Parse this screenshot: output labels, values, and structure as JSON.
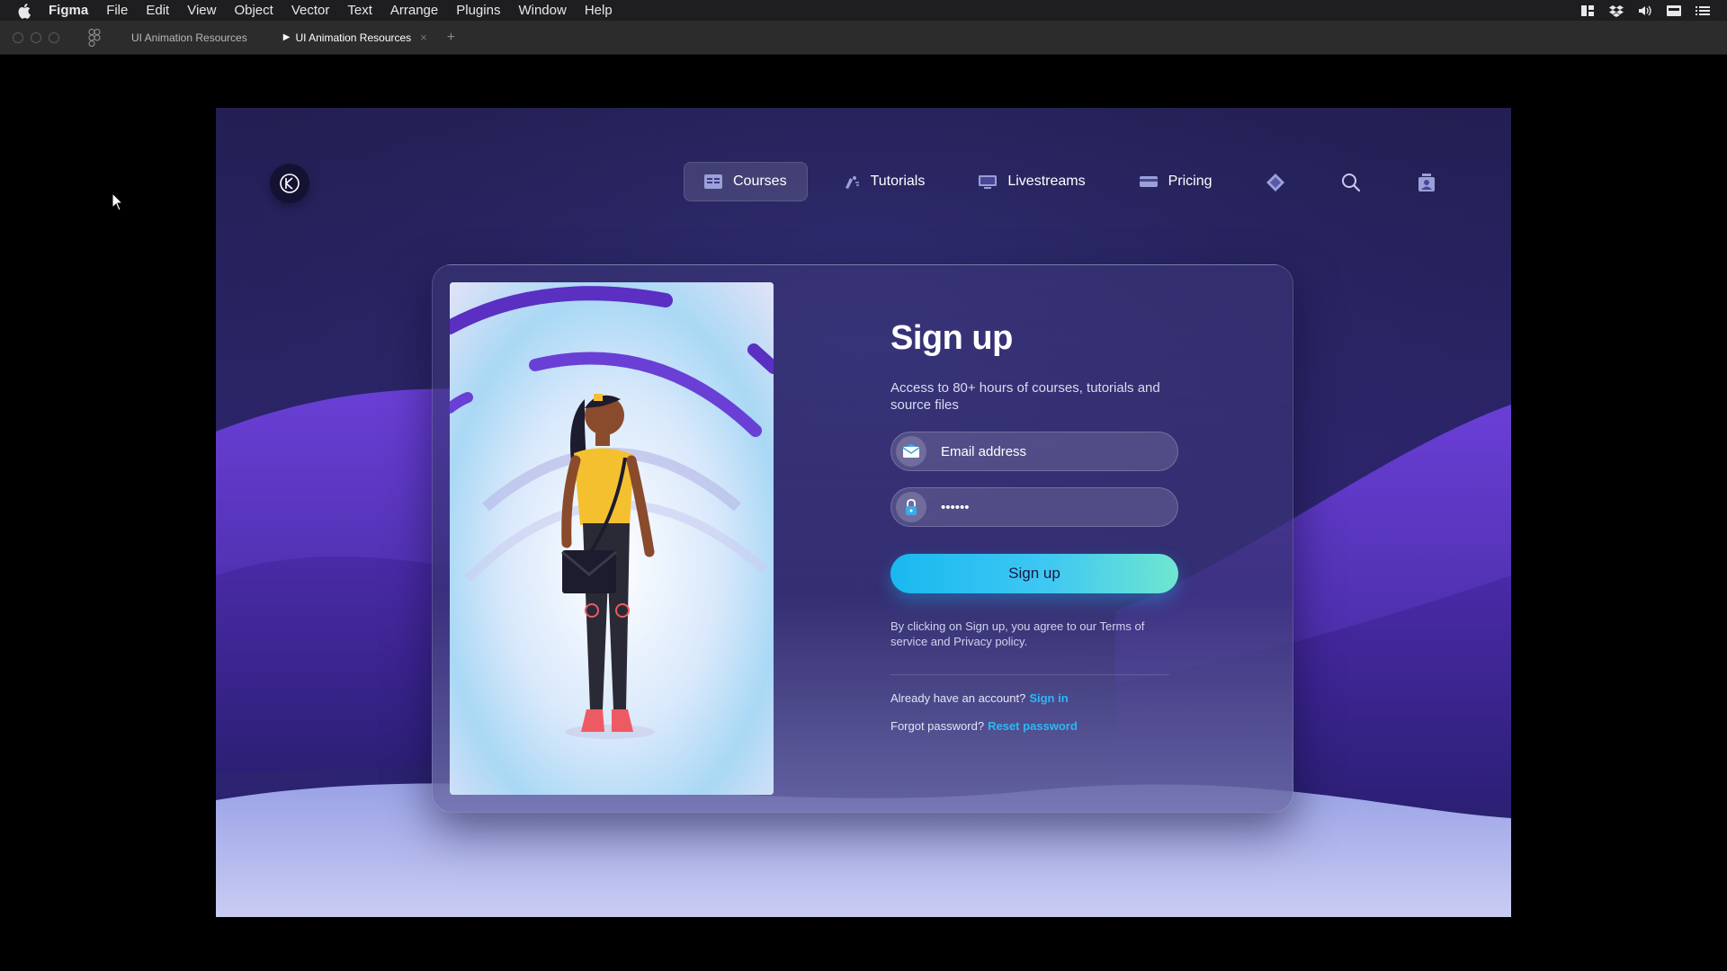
{
  "menubar": {
    "app": "Figma",
    "items": [
      "File",
      "Edit",
      "View",
      "Object",
      "Vector",
      "Text",
      "Arrange",
      "Plugins",
      "Window",
      "Help"
    ],
    "tray_icons": [
      "layout-icon",
      "dropbox-icon",
      "volume-icon",
      "flag-icon",
      "list-icon"
    ]
  },
  "tabbar": {
    "tabs": [
      {
        "label": "UI Animation Resources",
        "active": false
      },
      {
        "label": "UI Animation Resources",
        "active": true
      }
    ],
    "close_glyph": "×",
    "add_glyph": "+"
  },
  "site": {
    "nav": [
      {
        "label": "Courses",
        "icon": "courses-icon",
        "active": true
      },
      {
        "label": "Tutorials",
        "icon": "tutorials-icon",
        "active": false
      },
      {
        "label": "Livestreams",
        "icon": "livestreams-icon",
        "active": false
      },
      {
        "label": "Pricing",
        "icon": "pricing-icon",
        "active": false
      }
    ],
    "nav_icons": [
      "diamond-icon",
      "search-icon",
      "account-icon"
    ]
  },
  "signup": {
    "title": "Sign up",
    "subtitle": "Access to 80+ hours of courses, tutorials and source files",
    "email_placeholder": "Email address",
    "password_value": "••••••",
    "button": "Sign up",
    "legal": "By clicking on Sign up, you agree to our Terms of service and Privacy policy.",
    "have_account": "Already have an account?",
    "sign_in": "Sign in",
    "forgot": "Forgot password?",
    "reset": "Reset password"
  },
  "colors": {
    "accent": "#2bb8f5",
    "button_start": "#19b8f0",
    "button_end": "#6fe6cf",
    "background": "#2a2466"
  }
}
